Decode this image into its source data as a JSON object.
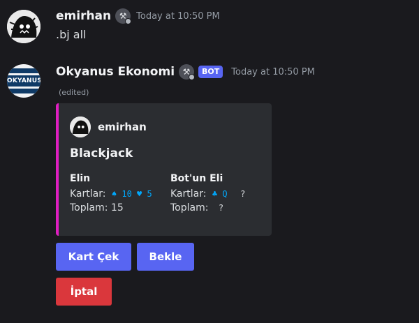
{
  "colors": {
    "background": "#1a1a1e",
    "embed_background": "#2b2d31",
    "embed_accent": "#e01ec2",
    "blurple": "#5865f2",
    "danger": "#da373c",
    "code_blue": "#00a8fc"
  },
  "user_message": {
    "username": "emirhan",
    "timestamp": "Today at 10:50 PM",
    "content": ".bj all",
    "badge_icon": "hammer-wrench-icon"
  },
  "bot_message": {
    "username": "Okyanus Ekonomi",
    "bot_tag": "BOT",
    "timestamp": "Today at 10:50 PM",
    "edited_label": "(edited)",
    "avatar_logo_text": "OKYANUS",
    "badge_icon": "hammer-wrench-icon"
  },
  "embed": {
    "author": "emirhan",
    "title": "Blackjack",
    "fields": [
      {
        "name": "Elin",
        "cards_label": "Kartlar:",
        "cards": "♠ 10 ♥ 5",
        "total_label": "Toplam:",
        "total": "15"
      },
      {
        "name": "Bot'un Eli",
        "cards_label": "Kartlar:",
        "cards": "♣ Q",
        "hidden_card": "?",
        "total_label": "Toplam:",
        "total": "?"
      }
    ]
  },
  "buttons": {
    "draw_label": "Kart Çek",
    "stand_label": "Bekle",
    "cancel_label": "İptal"
  }
}
